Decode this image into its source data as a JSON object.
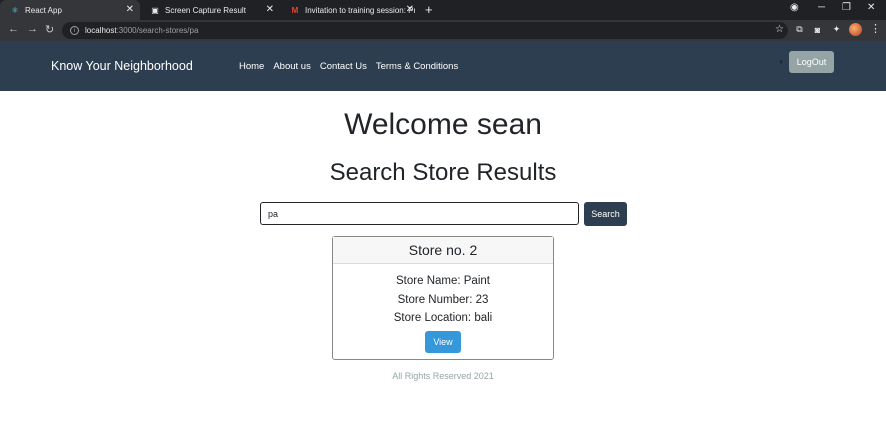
{
  "browser": {
    "tabs": [
      {
        "title": "React App",
        "icon": "react-icon",
        "active": true
      },
      {
        "title": "Screen Capture Result",
        "icon": "camera-icon",
        "active": false
      },
      {
        "title": "Invitation to training session: Pro",
        "icon": "gmail-icon",
        "active": false
      }
    ],
    "url_host": "localhost",
    "url_path": ":3000/search-stores/pa"
  },
  "navbar": {
    "brand": "Know Your Neighborhood",
    "links": [
      "Home",
      "About us",
      "Contact Us",
      "Terms & Conditions"
    ],
    "logout_label": "LogOut"
  },
  "main": {
    "welcome": "Welcome sean",
    "heading": "Search Store Results",
    "search_value": "pa",
    "search_button": "Search"
  },
  "card": {
    "title": "Store no. 2",
    "name_line": "Store Name: Paint",
    "number_line": "Store Number: 23",
    "location_line": "Store Location: bali",
    "view_label": "View"
  },
  "footer": {
    "text": "All Rights Reserved 2021"
  }
}
